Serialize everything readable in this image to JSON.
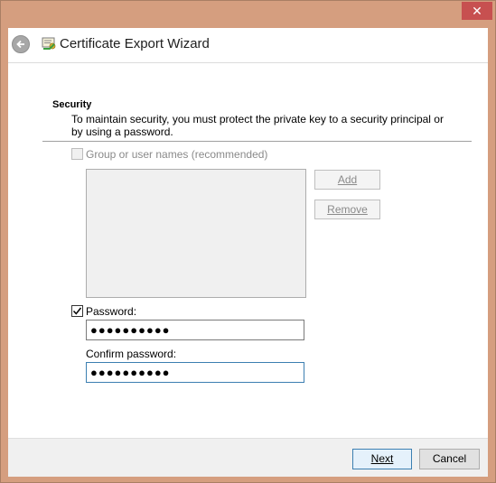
{
  "window": {
    "close_glyph": "✕"
  },
  "header": {
    "title": "Certificate Export Wizard"
  },
  "section": {
    "title": "Security",
    "description": "To maintain security, you must protect the private key to a security principal or by using a password."
  },
  "group": {
    "checkbox_label": "Group or user names (recommended)",
    "checked": false,
    "add_label": "Add",
    "remove_label": "Remove"
  },
  "password": {
    "checkbox_label": "Password:",
    "checked": true,
    "value": "●●●●●●●●●●"
  },
  "confirm": {
    "label": "Confirm password:",
    "value": "●●●●●●●●●●"
  },
  "footer": {
    "next_label": "Next",
    "cancel_label": "Cancel"
  },
  "colors": {
    "window_frame": "#d59e7f",
    "close_button": "#c75050",
    "focus_border": "#3c7fb1"
  },
  "icons": [
    "back-arrow-icon",
    "certificate-icon",
    "close-icon",
    "checkmark-icon"
  ]
}
